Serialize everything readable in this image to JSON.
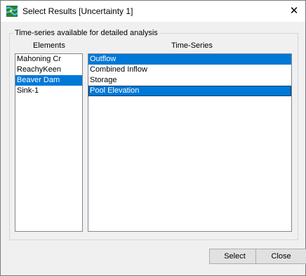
{
  "window": {
    "title": "Select Results [Uncertainty 1]",
    "icon": "hec-hms-app-icon",
    "close_glyph": "✕"
  },
  "group": {
    "legend": "Time-series available for detailed analysis"
  },
  "elements": {
    "header": "Elements",
    "items": [
      {
        "label": "Mahoning Cr",
        "selected": false
      },
      {
        "label": "ReachyKeen",
        "selected": false
      },
      {
        "label": "Beaver Dam",
        "selected": true
      },
      {
        "label": "Sink-1",
        "selected": false
      }
    ]
  },
  "timeseries": {
    "header": "Time-Series",
    "items": [
      {
        "label": "Outflow",
        "selected": true
      },
      {
        "label": "Combined Inflow",
        "selected": false
      },
      {
        "label": "Storage",
        "selected": false
      },
      {
        "label": "Pool Elevation",
        "selected": true
      }
    ]
  },
  "buttons": {
    "select": "Select",
    "close": "Close"
  },
  "colors": {
    "selection": "#0078d7",
    "window_bg": "#f0f0f0"
  }
}
